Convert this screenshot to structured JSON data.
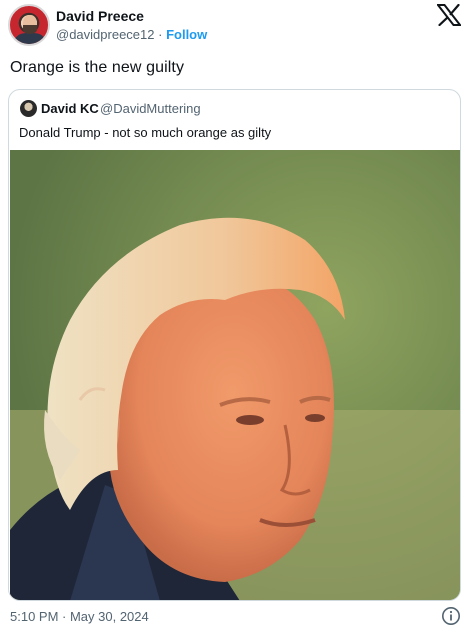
{
  "author": {
    "display_name": "David Preece",
    "handle": "@davidpreece12",
    "separator": "·",
    "follow_label": "Follow"
  },
  "tweet": {
    "text": "Orange is the new guilty",
    "timestamp": "5:10 PM · May 30, 2024"
  },
  "quoted": {
    "display_name": "David KC",
    "handle": "@DavidMuttering",
    "text": "Donald Trump - not so much orange as gilty"
  },
  "icons": {
    "platform_logo": "x-logo-icon",
    "info": "info-icon"
  },
  "colors": {
    "accent": "#1d9bf0",
    "secondary_text": "#536471",
    "border": "#cfd9de"
  }
}
